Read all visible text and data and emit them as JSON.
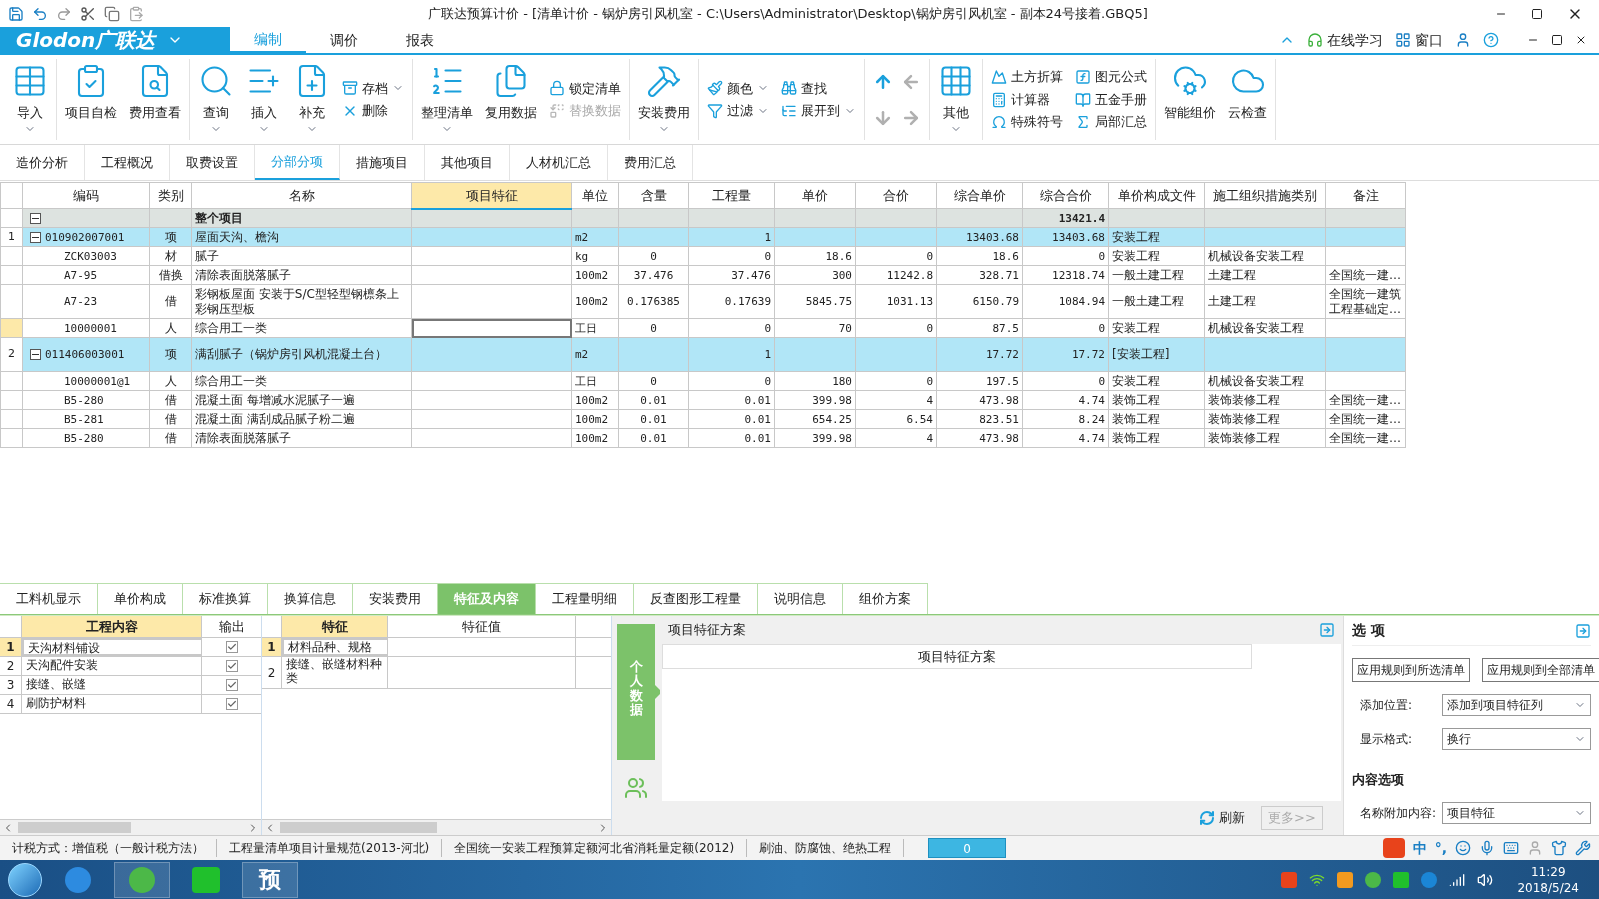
{
  "window": {
    "title": "广联达预算计价 - [清单计价 - 锅炉房引风机室 - C:\\Users\\Administrator\\Desktop\\锅炉房引风机室 - 副本24号接着.GBQ5]"
  },
  "menu": {
    "logo": "Glodon广联达",
    "tabs": [
      {
        "label": "编制",
        "selected": true
      },
      {
        "label": "调价",
        "selected": false
      },
      {
        "label": "报表",
        "selected": false
      }
    ],
    "right": [
      {
        "label": "在线学习"
      },
      {
        "label": "窗口"
      }
    ]
  },
  "ribbon": [
    {
      "items": [
        {
          "kind": "large",
          "label": "导入",
          "dropdown": true
        }
      ]
    },
    {
      "items": [
        {
          "kind": "large",
          "label": "项目自检",
          "dropdown": false
        },
        {
          "kind": "large",
          "label": "费用查看",
          "dropdown": false
        }
      ]
    },
    {
      "items": [
        {
          "kind": "large",
          "label": "查询",
          "dropdown": true
        },
        {
          "kind": "large",
          "label": "插入",
          "dropdown": true
        },
        {
          "kind": "large",
          "label": "补充",
          "dropdown": true
        },
        {
          "kind": "stack",
          "items": [
            {
              "label": "存档",
              "dropdown": true,
              "disabled": false
            },
            {
              "label": "删除",
              "dropdown": false,
              "disabled": false
            }
          ]
        }
      ]
    },
    {
      "items": [
        {
          "kind": "large",
          "label": "整理清单",
          "dropdown": true
        },
        {
          "kind": "large",
          "label": "复用数据",
          "dropdown": false
        },
        {
          "kind": "stack",
          "items": [
            {
              "label": "锁定清单",
              "dropdown": false,
              "disabled": false
            },
            {
              "label": "替换数据",
              "dropdown": false,
              "disabled": true
            }
          ]
        }
      ]
    },
    {
      "items": [
        {
          "kind": "large",
          "label": "安装费用",
          "dropdown": true
        }
      ]
    },
    {
      "items": [
        {
          "kind": "stack",
          "items": [
            {
              "label": "颜色",
              "dropdown": true,
              "disabled": false
            },
            {
              "label": "过滤",
              "dropdown": true,
              "disabled": false
            }
          ]
        },
        {
          "kind": "stack",
          "items": [
            {
              "label": "查找",
              "dropdown": false,
              "disabled": false
            },
            {
              "label": "展开到",
              "dropdown": true,
              "disabled": false
            }
          ]
        }
      ]
    },
    {
      "items": [
        {
          "kind": "arrows",
          "buttons": [
            {
              "disabled": false
            },
            {
              "disabled": true
            },
            {
              "disabled": true
            },
            {
              "disabled": true
            }
          ]
        }
      ]
    },
    {
      "items": [
        {
          "kind": "large",
          "label": "其他",
          "dropdown": true
        }
      ]
    },
    {
      "items": [
        {
          "kind": "stack",
          "items": [
            {
              "label": "土方折算",
              "dropdown": false,
              "disabled": false
            },
            {
              "label": "计算器",
              "dropdown": false,
              "disabled": false
            },
            {
              "label": "特殊符号",
              "dropdown": false,
              "disabled": false
            }
          ]
        },
        {
          "kind": "stack",
          "items": [
            {
              "label": "图元公式",
              "dropdown": false,
              "disabled": false
            },
            {
              "label": "五金手册",
              "dropdown": false,
              "disabled": false
            },
            {
              "label": "局部汇总",
              "dropdown": false,
              "disabled": false
            }
          ]
        }
      ]
    },
    {
      "items": [
        {
          "kind": "large",
          "label": "智能组价",
          "dropdown": false
        },
        {
          "kind": "large",
          "label": "云检查",
          "dropdown": false
        }
      ]
    }
  ],
  "nav_tabs": [
    {
      "label": "造价分析",
      "selected": false
    },
    {
      "label": "工程概况",
      "selected": false
    },
    {
      "label": "取费设置",
      "selected": false
    },
    {
      "label": "分部分项",
      "selected": true
    },
    {
      "label": "措施项目",
      "selected": false
    },
    {
      "label": "其他项目",
      "selected": false
    },
    {
      "label": "人材机汇总",
      "selected": false
    },
    {
      "label": "费用汇总",
      "selected": false
    }
  ],
  "table": {
    "columns": [
      {
        "label": "编码",
        "selected": false
      },
      {
        "label": "类别",
        "selected": false
      },
      {
        "label": "名称",
        "selected": false
      },
      {
        "label": "项目特征",
        "selected": true
      },
      {
        "label": "单位",
        "selected": false
      },
      {
        "label": "含量",
        "selected": false
      },
      {
        "label": "工程量",
        "selected": false
      },
      {
        "label": "单价",
        "selected": false
      },
      {
        "label": "合价",
        "selected": false
      },
      {
        "label": "综合单价",
        "selected": false
      },
      {
        "label": "综合合价",
        "selected": false
      },
      {
        "label": "单价构成文件",
        "selected": false
      },
      {
        "label": "施工组织措施类别",
        "selected": false
      },
      {
        "label": "备注",
        "selected": false
      }
    ],
    "rows": [
      {
        "kind": "total",
        "selected": false,
        "expanded": true,
        "cells": [
          null,
          null,
          "整个项目",
          null,
          null,
          null,
          null,
          null,
          null,
          null,
          "13421.4",
          null,
          null,
          null
        ]
      },
      {
        "kind": "item",
        "row_number": "1",
        "selected": false,
        "expanded": true,
        "cells": [
          "010902007001",
          "项",
          "屋面天沟、檐沟",
          null,
          "m2",
          null,
          "1",
          null,
          null,
          "13403.68",
          "13403.68",
          "安装工程",
          null,
          null
        ]
      },
      {
        "kind": "sub",
        "selected": false,
        "cells": [
          "ZCK03003",
          "材",
          "腻子",
          null,
          "kg",
          "0",
          "0",
          "18.6",
          "0",
          "18.6",
          "0",
          "安装工程",
          "机械设备安装工程",
          null
        ]
      },
      {
        "kind": "sub",
        "selected": false,
        "cells": [
          "A7-95",
          "借换",
          "清除表面脱落腻子",
          null,
          "100m2",
          "37.476",
          "37.476",
          "300",
          "11242.8",
          "328.71",
          "12318.74",
          "一般土建工程",
          "土建工程",
          "全国统一建…"
        ]
      },
      {
        "kind": "sub",
        "selected": false,
        "tall": true,
        "cells": [
          "A7-23",
          "借",
          "彩钢板屋面 安装于S/C型轻型钢檩条上彩钢压型板",
          null,
          "100m2",
          "0.176385",
          "0.17639",
          "5845.75",
          "1031.13",
          "6150.79",
          "1084.94",
          "一般土建工程",
          "土建工程",
          "全国统一建筑工程基础定…"
        ]
      },
      {
        "kind": "sub",
        "selected": true,
        "cells": [
          "10000001",
          "人",
          "综合用工一类",
          null,
          "工日",
          "0",
          "0",
          "70",
          "0",
          "87.5",
          "0",
          "安装工程",
          "机械设备安装工程",
          null
        ]
      },
      {
        "kind": "item",
        "row_number": "2",
        "selected": false,
        "expanded": true,
        "tall": true,
        "cells": [
          "011406003001",
          "项",
          "满刮腻子（锅炉房引风机混凝土台）",
          null,
          "m2",
          null,
          "1",
          null,
          null,
          "17.72",
          "17.72",
          "[安装工程]",
          null,
          null
        ]
      },
      {
        "kind": "sub",
        "selected": false,
        "cells": [
          "10000001@1",
          "人",
          "综合用工一类",
          null,
          "工日",
          "0",
          "0",
          "180",
          "0",
          "197.5",
          "0",
          "安装工程",
          "机械设备安装工程",
          null
        ]
      },
      {
        "kind": "sub",
        "selected": false,
        "cells": [
          "B5-280",
          "借",
          "混凝土面 每增减水泥腻子一遍",
          null,
          "100m2",
          "0.01",
          "0.01",
          "399.98",
          "4",
          "473.98",
          "4.74",
          "装饰工程",
          "装饰装修工程",
          "全国统一建…"
        ]
      },
      {
        "kind": "sub",
        "selected": false,
        "cells": [
          "B5-281",
          "借",
          "混凝土面 满刮成品腻子粉二遍",
          null,
          "100m2",
          "0.01",
          "0.01",
          "654.25",
          "6.54",
          "823.51",
          "8.24",
          "装饰工程",
          "装饰装修工程",
          "全国统一建…"
        ]
      },
      {
        "kind": "sub",
        "selected": false,
        "cells": [
          "B5-280",
          "借",
          "清除表面脱落腻子",
          null,
          "100m2",
          "0.01",
          "0.01",
          "399.98",
          "4",
          "473.98",
          "4.74",
          "装饰工程",
          "装饰装修工程",
          "全国统一建…"
        ]
      }
    ]
  },
  "detail_tabs": [
    {
      "label": "工料机显示",
      "selected": false
    },
    {
      "label": "单价构成",
      "selected": false
    },
    {
      "label": "标准换算",
      "selected": false
    },
    {
      "label": "换算信息",
      "selected": false
    },
    {
      "label": "安装费用",
      "selected": false
    },
    {
      "label": "特征及内容",
      "selected": true
    },
    {
      "label": "工程量明细",
      "selected": false
    },
    {
      "label": "反查图形工程量",
      "selected": false
    },
    {
      "label": "说明信息",
      "selected": false
    },
    {
      "label": "组价方案",
      "selected": false
    }
  ],
  "work_content": {
    "columns": [
      "工程内容",
      "输出"
    ],
    "rows": [
      {
        "number": "1",
        "content": "天沟材料铺设",
        "output": true,
        "selected": true
      },
      {
        "number": "2",
        "content": "天沟配件安装",
        "output": true,
        "selected": false
      },
      {
        "number": "3",
        "content": "接缝、嵌缝",
        "output": true,
        "selected": false
      },
      {
        "number": "4",
        "content": "刷防护材料",
        "output": true,
        "selected": false
      }
    ]
  },
  "features": {
    "columns": [
      "特征",
      "特征值"
    ],
    "rows": [
      {
        "number": "1",
        "feature": "材料品种、规格",
        "selected": true
      },
      {
        "number": "2",
        "feature": "接缝、嵌缝材料种类",
        "selected": false
      }
    ]
  },
  "side_tab": {
    "label": "个人数据",
    "selected": true
  },
  "scheme": {
    "title": "项目特征方案",
    "header": "项目特征方案",
    "refresh": "刷新",
    "more": {
      "label": "更多>>",
      "disabled": true
    }
  },
  "options": {
    "title": "选 项",
    "buttons": [
      "应用规则到所选清单",
      "应用规则到全部清单"
    ],
    "fields": [
      {
        "label": "添加位置:",
        "value": "添加到项目特征列"
      },
      {
        "label": "显示格式:",
        "value": "换行"
      }
    ],
    "section": "内容选项",
    "section_fields": [
      {
        "label": "名称附加内容:",
        "value": "项目特征"
      }
    ]
  },
  "status_bar": {
    "items": [
      "计税方式：增值税（一般计税方法）",
      "工程量清单项目计量规范(2013-河北)",
      "全国统一安装工程预算定额河北省消耗量定额(2012)",
      "刷油、防腐蚀、绝热工程"
    ],
    "counter": "0",
    "ime": [
      "中",
      "°,"
    ]
  },
  "taskbar": {
    "app_label": "预",
    "time": "11:29",
    "date": "2018/5/24"
  }
}
